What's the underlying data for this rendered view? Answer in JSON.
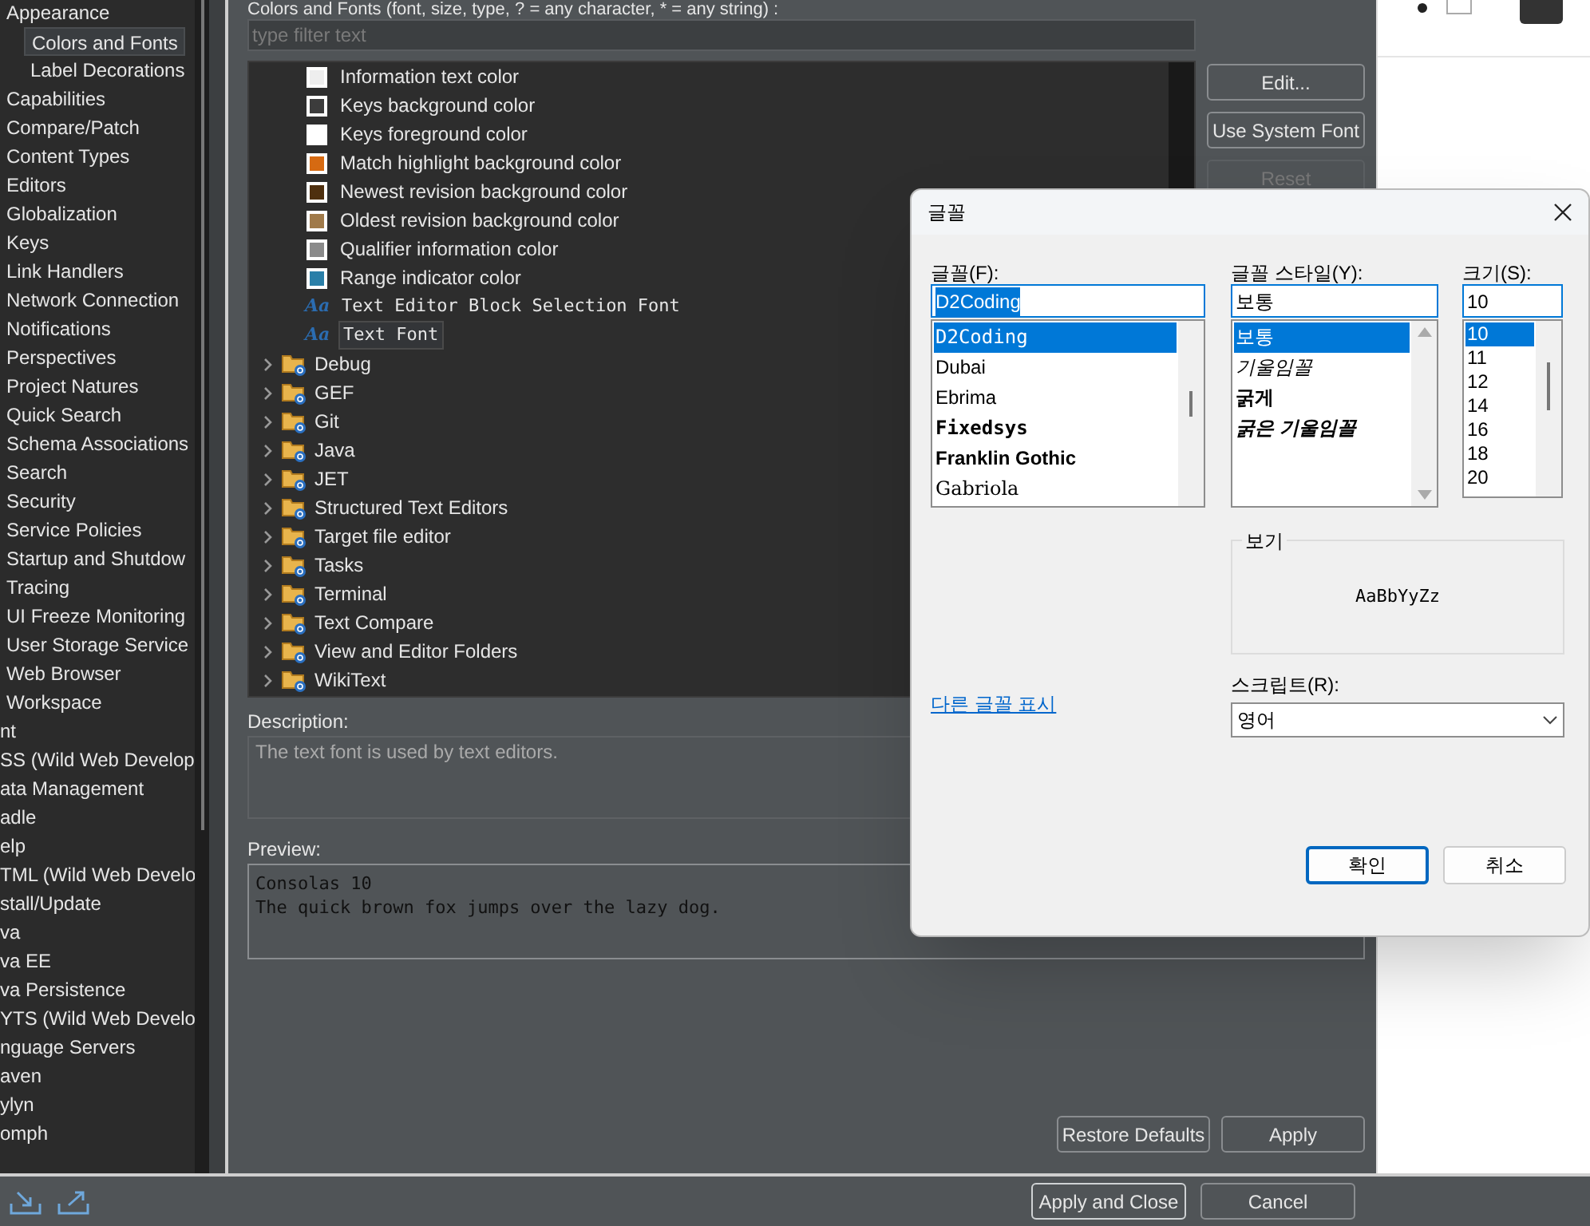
{
  "sidebar": {
    "items": [
      {
        "label": "Appearance",
        "selected": false,
        "children": [
          {
            "label": "Colors and Fonts",
            "selected": true
          },
          {
            "label": "Label Decorations",
            "selected": false
          }
        ]
      },
      {
        "label": "Capabilities",
        "selected": false
      },
      {
        "label": "Compare/Patch",
        "selected": false
      },
      {
        "label": "Content Types",
        "selected": false
      },
      {
        "label": "Editors",
        "selected": false
      },
      {
        "label": "Globalization",
        "selected": false
      },
      {
        "label": "Keys",
        "selected": false
      },
      {
        "label": "Link Handlers",
        "selected": false
      },
      {
        "label": "Network Connection",
        "selected": false
      },
      {
        "label": "Notifications",
        "selected": false
      },
      {
        "label": "Perspectives",
        "selected": false
      },
      {
        "label": "Project Natures",
        "selected": false
      },
      {
        "label": "Quick Search",
        "selected": false
      },
      {
        "label": "Schema Associations",
        "selected": false
      },
      {
        "label": "Search",
        "selected": false
      },
      {
        "label": "Security",
        "selected": false
      },
      {
        "label": "Service Policies",
        "selected": false
      },
      {
        "label": "Startup and Shutdow",
        "selected": false
      },
      {
        "label": "Tracing",
        "selected": false
      },
      {
        "label": "UI Freeze Monitoring",
        "selected": false
      },
      {
        "label": "User Storage Service",
        "selected": false
      },
      {
        "label": "Web Browser",
        "selected": false
      },
      {
        "label": "Workspace",
        "selected": false
      }
    ],
    "outer_items": [
      {
        "label": "nt",
        "selected": false
      },
      {
        "label": "SS (Wild Web Develop",
        "selected": false
      },
      {
        "label": "ata Management",
        "selected": false
      },
      {
        "label": "adle",
        "selected": false
      },
      {
        "label": "elp",
        "selected": false
      },
      {
        "label": "TML (Wild Web Develo",
        "selected": false
      },
      {
        "label": "stall/Update",
        "selected": false
      },
      {
        "label": "va",
        "selected": false
      },
      {
        "label": "va EE",
        "selected": false
      },
      {
        "label": "va Persistence",
        "selected": false
      },
      {
        "label": "YTS (Wild Web Develo",
        "selected": false
      },
      {
        "label": "nguage Servers",
        "selected": false
      },
      {
        "label": "aven",
        "selected": false
      },
      {
        "label": "ylyn",
        "selected": false
      },
      {
        "label": "omph",
        "selected": false
      }
    ]
  },
  "main": {
    "heading": "Colors and Fonts (font, size, type, ? = any character, * = any string) :",
    "filter": {
      "placeholder": "type filter text"
    },
    "tree": [
      {
        "kind": "color",
        "label": "Information text color",
        "color": "#eeeeee",
        "selected": false
      },
      {
        "kind": "color",
        "label": "Keys background color",
        "color": "#3c3c3c",
        "selected": false
      },
      {
        "kind": "color",
        "label": "Keys foreground color",
        "color": "#ffffff",
        "selected": false
      },
      {
        "kind": "color",
        "label": "Match highlight background color",
        "color": "#d66a12",
        "selected": false
      },
      {
        "kind": "color",
        "label": "Newest revision background color",
        "color": "#4e2f0e",
        "selected": false
      },
      {
        "kind": "color",
        "label": "Oldest revision background color",
        "color": "#a07a4a",
        "selected": false
      },
      {
        "kind": "color",
        "label": "Qualifier information color",
        "color": "#8a8a8a",
        "selected": false
      },
      {
        "kind": "color",
        "label": "Range indicator color",
        "color": "#2a7fa8",
        "selected": false
      },
      {
        "kind": "font",
        "icon": "Aa",
        "label": "Text Editor Block Selection Font",
        "selected": false
      },
      {
        "kind": "font",
        "icon": "Aa",
        "label": "Text Font",
        "selected": true
      },
      {
        "kind": "category",
        "label": "Debug",
        "expanded": false,
        "selected": false
      },
      {
        "kind": "category",
        "label": "GEF",
        "expanded": false,
        "selected": false
      },
      {
        "kind": "category",
        "label": "Git",
        "expanded": false,
        "selected": false
      },
      {
        "kind": "category",
        "label": "Java",
        "expanded": false,
        "selected": false
      },
      {
        "kind": "category",
        "label": "JET",
        "expanded": false,
        "selected": false
      },
      {
        "kind": "category",
        "label": "Structured Text Editors",
        "expanded": false,
        "selected": false
      },
      {
        "kind": "category",
        "label": "Target file editor",
        "expanded": false,
        "selected": false
      },
      {
        "kind": "category",
        "label": "Tasks",
        "expanded": false,
        "selected": false
      },
      {
        "kind": "category",
        "label": "Terminal",
        "expanded": false,
        "selected": false
      },
      {
        "kind": "category",
        "label": "Text Compare",
        "expanded": false,
        "selected": false
      },
      {
        "kind": "category",
        "label": "View and Editor Folders",
        "expanded": false,
        "selected": false
      },
      {
        "kind": "category",
        "label": "WikiText",
        "expanded": false,
        "selected": false
      }
    ],
    "side_buttons": [
      {
        "label": "Edit...",
        "disabled": false
      },
      {
        "label": "Use System Font",
        "disabled": false
      },
      {
        "label": "Reset",
        "disabled": true
      }
    ],
    "description_label": "Description:",
    "description": "The text font is used by text editors.",
    "preview_label": "Preview:",
    "preview_lines": [
      "Consolas 10",
      "The quick brown fox jumps over the lazy dog."
    ],
    "buttons": [
      "Restore Defaults",
      "Apply"
    ]
  },
  "footer": {
    "buttons": [
      {
        "label": "Apply and Close",
        "default": true
      },
      {
        "label": "Cancel",
        "default": false
      }
    ]
  },
  "font_dialog": {
    "title": "글꼴",
    "font": {
      "label": "글꼴(F):",
      "value": "D2Coding",
      "items": [
        {
          "label": "D2Coding",
          "kind": "mono",
          "selected": true
        },
        {
          "label": "Dubai",
          "kind": "plain",
          "selected": false
        },
        {
          "label": "Ebrima",
          "kind": "plain",
          "selected": false
        },
        {
          "label": "Fixedsys",
          "kind": "monobold",
          "selected": false
        },
        {
          "label": "Franklin Gothic",
          "kind": "bold",
          "selected": false
        },
        {
          "label": "Gabriola",
          "kind": "serif",
          "selected": false
        }
      ]
    },
    "style": {
      "label": "글꼴 스타일(Y):",
      "value": "보통",
      "items": [
        {
          "label": "보통",
          "kind": "regular",
          "selected": true
        },
        {
          "label": "기울임꼴",
          "kind": "italic",
          "selected": false
        },
        {
          "label": "굵게",
          "kind": "bold",
          "selected": false
        },
        {
          "label": "굵은 기울임꼴",
          "kind": "bolditalic",
          "selected": false
        }
      ]
    },
    "size": {
      "label": "크기(S):",
      "value": "10",
      "items": [
        {
          "label": "10",
          "selected": true
        },
        {
          "label": "11",
          "selected": false
        },
        {
          "label": "12",
          "selected": false
        },
        {
          "label": "14",
          "selected": false
        },
        {
          "label": "16",
          "selected": false
        },
        {
          "label": "18",
          "selected": false
        },
        {
          "label": "20",
          "selected": false
        }
      ]
    },
    "sample": {
      "label": "보기",
      "text": "AaBbYyZz"
    },
    "script": {
      "label": "스크립트(R):",
      "value": "영어"
    },
    "more_link": "다른 글꼴 표시",
    "buttons": [
      {
        "label": "확인",
        "default": true
      },
      {
        "label": "취소",
        "default": false
      }
    ]
  }
}
